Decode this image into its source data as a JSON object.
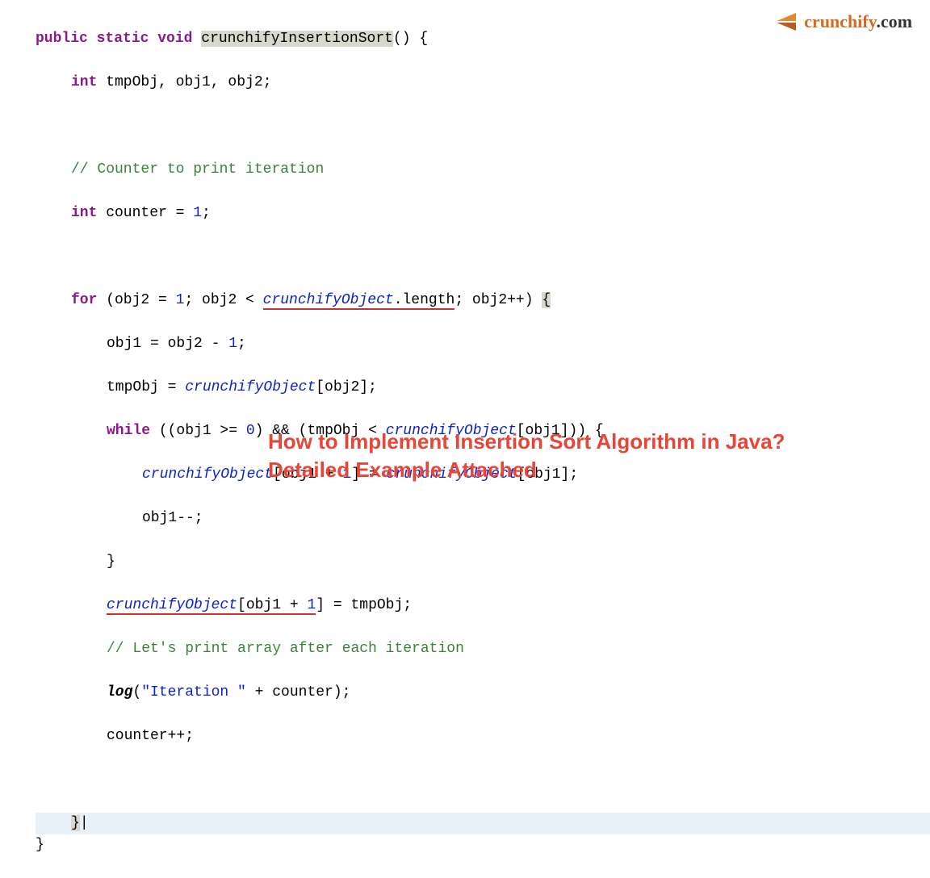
{
  "logo": {
    "brand": "crunchify",
    "tld": ".com"
  },
  "title": {
    "line1": "How to Implement Insertion Sort Algorithm in Java?",
    "line2": "Detailed Example Attached"
  },
  "code": {
    "kw_public": "public",
    "kw_static": "static",
    "kw_void": "void",
    "method_name": "crunchifyInsertionSort",
    "paren_open_brace": "() {",
    "kw_int": "int",
    "decl_tmp": " tmpObj, obj1, obj2;",
    "comment1": "// Counter to print iteration",
    "decl_counter_pre": " counter = ",
    "num_1": "1",
    "semicolon": ";",
    "kw_for": "for",
    "for_open": " (obj2 = ",
    "for_cond_pre": "; obj2 < ",
    "obj_name": "crunchifyObject",
    "dot_length": ".length",
    "for_post": "; obj2++) ",
    "brace_open": "{",
    "line_obj1_assign": "obj1 = obj2 - ",
    "line_tmp_assign_pre": "tmpObj = ",
    "bracket_obj2": "[obj2];",
    "kw_while": "while",
    "while_cond_pre": " ((obj1 >= ",
    "num_0": "0",
    "while_cond_mid": ") && (tmpObj < ",
    "bracket_obj1_close": "[obj1])) {",
    "inner_assign_pre": "",
    "bracket_obj1_plus1_eq": "[obj1 + ",
    "close_bracket_eq": "] = ",
    "bracket_obj1": "[obj1];",
    "line_obj1_dec": "obj1--;",
    "brace_close": "}",
    "assign_tmp_post": "] = tmpObj;",
    "comment2": "// Let's print array after each iteration",
    "log_name": "log",
    "log_open": "(",
    "str_iteration": "\"Iteration \"",
    "log_plus_counter": " + counter);",
    "line_counter_inc": "counter++;",
    "close_brace_cursor": "}",
    "cursor_char": "|"
  }
}
